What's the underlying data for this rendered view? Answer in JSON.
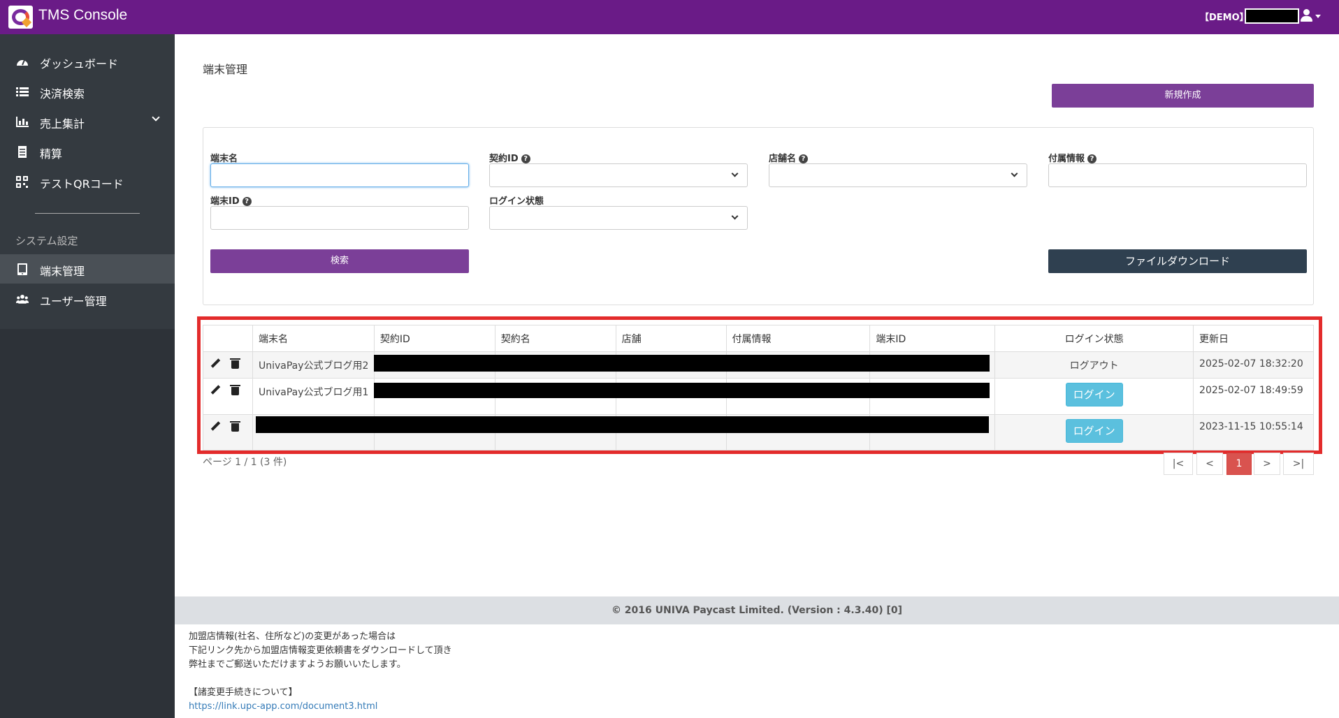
{
  "app": {
    "title": "TMS Console",
    "env": "【DEMO】"
  },
  "sidebar": {
    "items": [
      {
        "label": "ダッシュボード",
        "icon": "speedometer-icon"
      },
      {
        "label": "決済検索",
        "icon": "list-icon"
      },
      {
        "label": "売上集計",
        "icon": "bar-chart-icon",
        "expandable": true
      },
      {
        "label": "精算",
        "icon": "receipt-icon"
      },
      {
        "label": "テストQRコード",
        "icon": "qr-code-icon"
      }
    ],
    "section_label": "システム設定",
    "settings_items": [
      {
        "label": "端末管理",
        "icon": "tablet-icon",
        "active": true
      },
      {
        "label": "ユーザー管理",
        "icon": "users-icon"
      }
    ]
  },
  "main": {
    "page_title": "端末管理",
    "new_button": "新規作成",
    "search": {
      "terminal_name_label": "端末名",
      "contract_id_label": "契約ID",
      "store_name_label": "店舗名",
      "extra_info_label": "付属情報",
      "terminal_id_label": "端末ID",
      "login_state_label": "ログイン状態",
      "help_glyph": "?",
      "search_button": "検索",
      "download_button": "ファイルダウンロード"
    },
    "table": {
      "columns": [
        "端末名",
        "契約ID",
        "契約名",
        "店舗",
        "付属情報",
        "端末ID",
        "ログイン状態",
        "更新日"
      ],
      "rows": [
        {
          "name": "UnivaPay公式ブログ用2",
          "login_state": "ログアウト",
          "updated": "2025-02-07 18:32:20"
        },
        {
          "name": "UnivaPay公式ブログ用1",
          "login_state": "ログイン",
          "updated": "2025-02-07 18:49:59"
        },
        {
          "name": "",
          "login_state": "ログイン",
          "updated": "2023-11-15 10:55:14"
        }
      ]
    },
    "pagination": {
      "summary": "ページ 1 / 1 (3 件)",
      "first": "|<",
      "prev": "<",
      "current": "1",
      "next": ">",
      "last": ">|"
    }
  },
  "footer": {
    "copyright": "© 2016 UNIVA Paycast Limited. (Version : 4.3.40) [0]",
    "notice_line1": "加盟店情報(社名、住所など)の変更があった場合は",
    "notice_line2": "下記リンク先から加盟店情報変更依頼書をダウンロードして頂き",
    "notice_line3": "弊社までご郵送いただけますようお願いいたします。",
    "notice_heading": "【諸変更手続きについて】",
    "notice_link": "https://link.upc-app.com/document3.html"
  },
  "colors": {
    "topbar": "#6a1b87",
    "primary_button": "#7b3f98",
    "sidebar": "#343a40",
    "highlight": "#e32b2b"
  }
}
